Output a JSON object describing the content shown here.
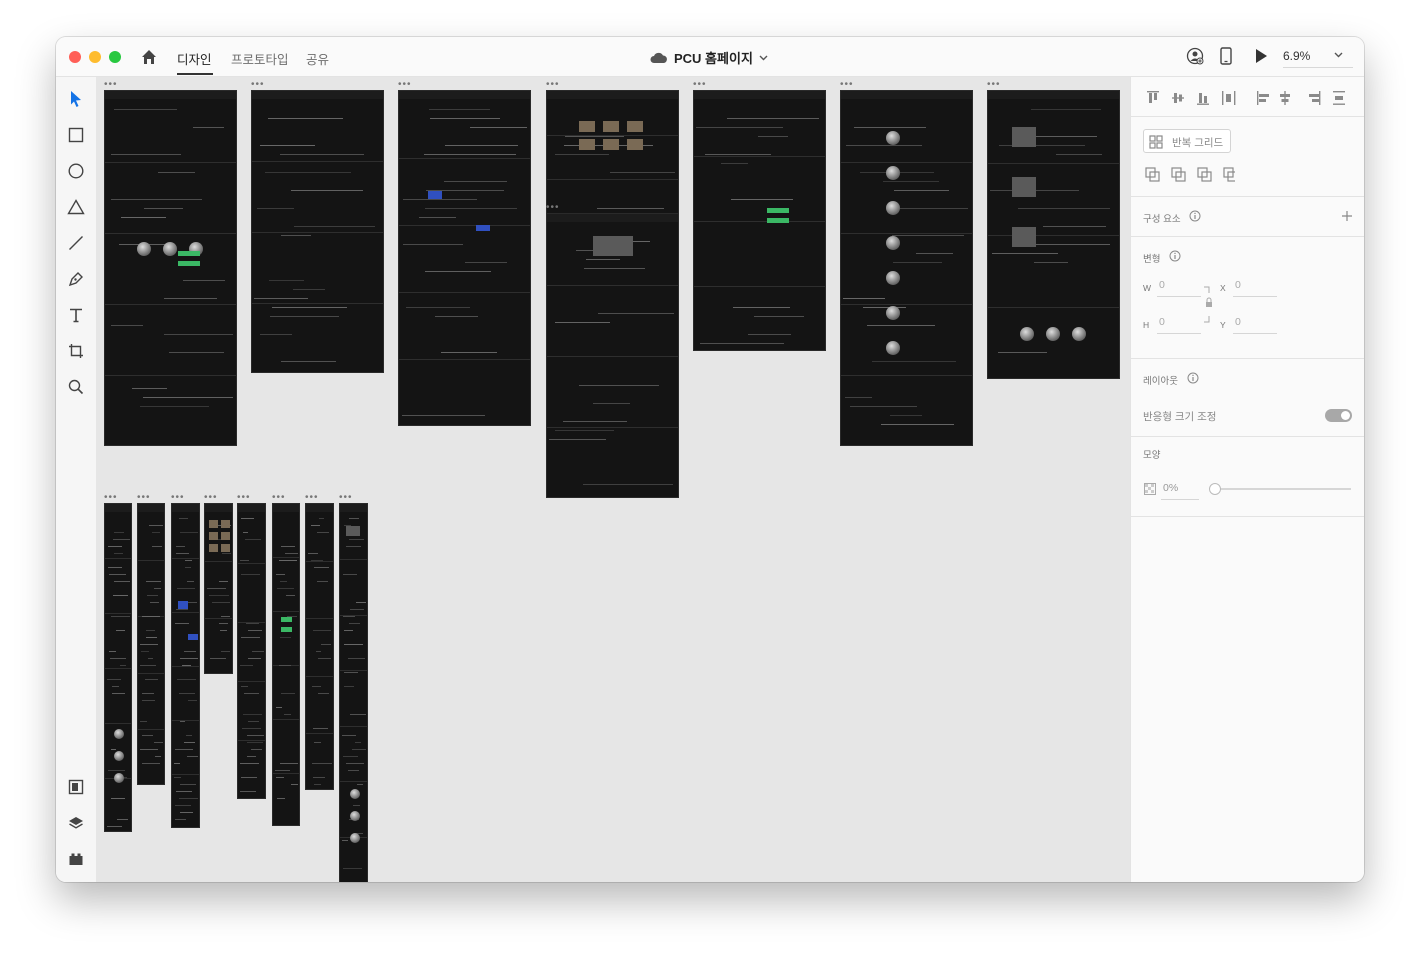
{
  "window": {
    "tabs": [
      "디자인",
      "프로토타입",
      "공유"
    ],
    "active_tab": "디자인",
    "document_title": "PCU 홈페이지",
    "zoom": "6.9%",
    "colors": {
      "accent": "#1473e6",
      "close": "#ff5f57",
      "minimize": "#febc2e",
      "maximize": "#28c840"
    }
  },
  "toolbar": {
    "tools": [
      "select-icon",
      "rectangle-icon",
      "ellipse-icon",
      "polygon-icon",
      "line-icon",
      "pen-icon",
      "text-icon",
      "artboard-icon",
      "zoom-icon"
    ],
    "bottom": [
      "assets-icon",
      "layers-icon",
      "plugins-icon"
    ]
  },
  "panel": {
    "repeat_grid": "반복 그리드",
    "components": "구성 요소",
    "transform": "변형",
    "w_label": "W",
    "w_value": "0",
    "x_label": "X",
    "x_value": "0",
    "h_label": "H",
    "h_value": "0",
    "y_label": "Y",
    "y_value": "0",
    "layout": "레이아웃",
    "responsive_resize": "반응형 크기 조정",
    "responsive_enabled": true,
    "appearance": "모양",
    "opacity": "0%",
    "opacity_level": 0
  }
}
